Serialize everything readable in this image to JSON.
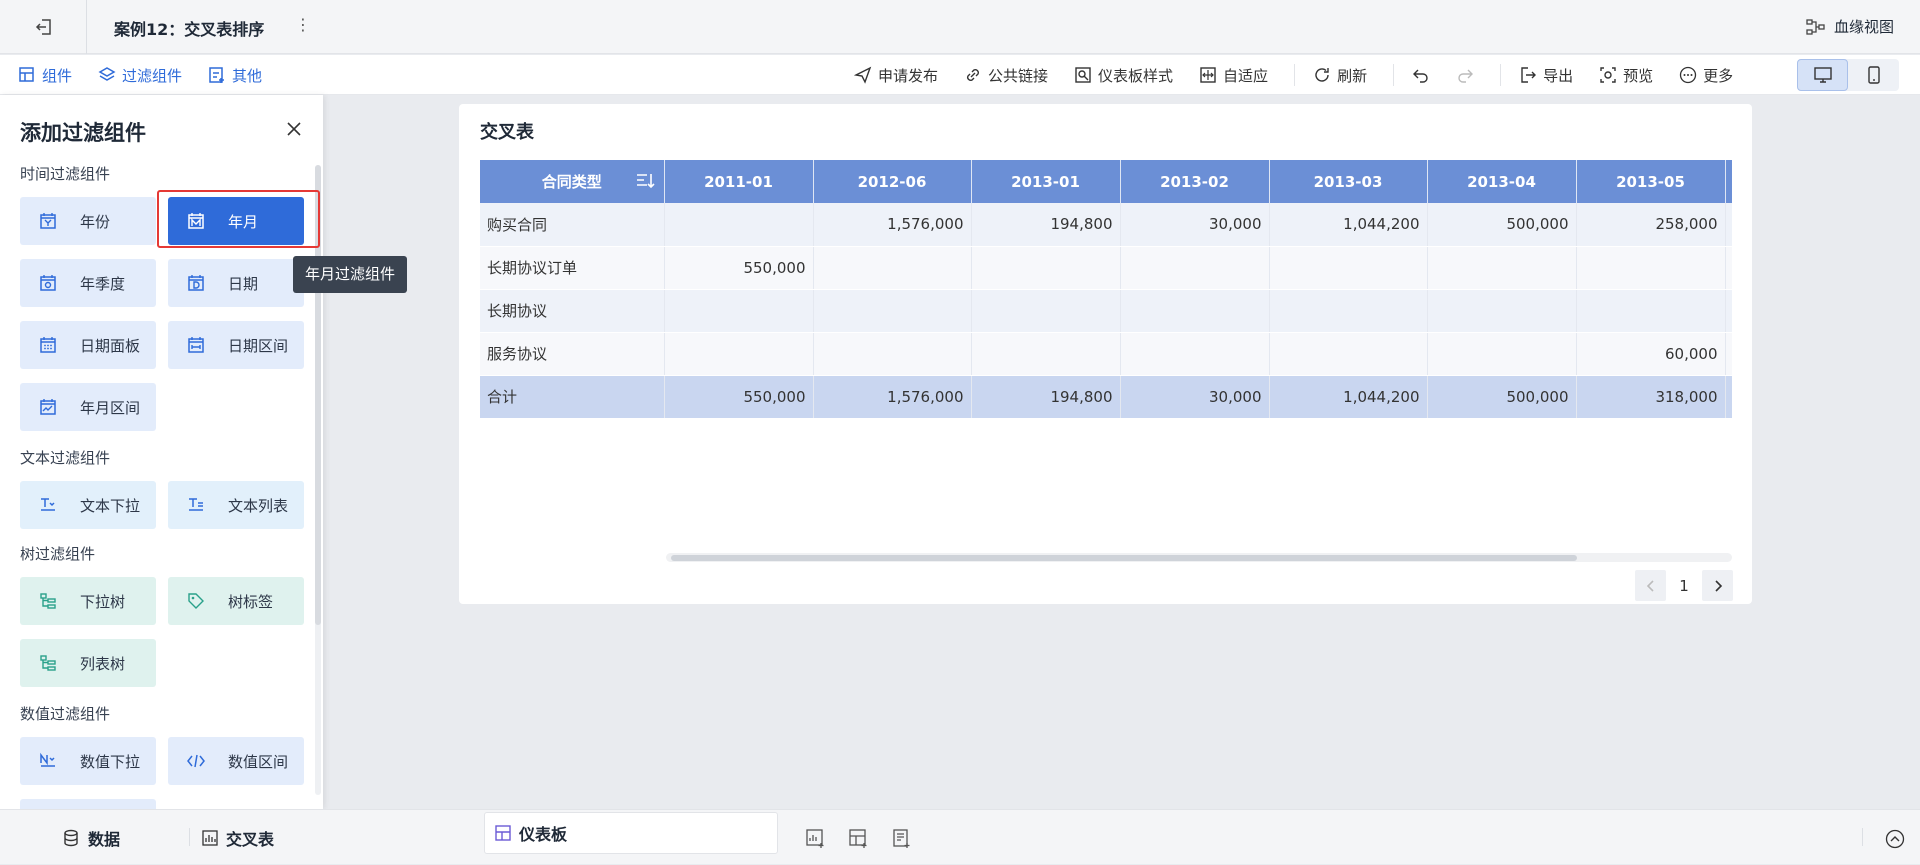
{
  "topbar": {
    "title": "案例12：交叉表排序",
    "lineage_label": "血缘视图"
  },
  "toolbar": {
    "left": [
      {
        "label": "组件",
        "icon": "add-component-icon"
      },
      {
        "label": "过滤组件",
        "icon": "filter-component-icon"
      },
      {
        "label": "其他",
        "icon": "other-icon"
      }
    ],
    "right": [
      {
        "label": "申请发布",
        "icon": "send-icon"
      },
      {
        "label": "公共链接",
        "icon": "link-icon"
      },
      {
        "label": "仪表板样式",
        "icon": "dashboard-style-icon"
      },
      {
        "label": "自适应",
        "icon": "adaptive-icon"
      },
      {
        "label": "刷新",
        "icon": "refresh-icon"
      },
      {
        "label": "导出",
        "icon": "export-icon"
      },
      {
        "label": "预览",
        "icon": "preview-icon"
      },
      {
        "label": "更多",
        "icon": "more-icon"
      }
    ]
  },
  "panel": {
    "title": "添加过滤组件",
    "sections": {
      "time": "时间过滤组件",
      "text": "文本过滤组件",
      "tree": "树过滤组件",
      "number": "数值过滤组件"
    },
    "buttons": {
      "year": "年份",
      "year_month": "年月",
      "year_quarter": "年季度",
      "date": "日期",
      "date_panel": "日期面板",
      "date_range": "日期区间",
      "year_month_range": "年月区间",
      "text_dropdown": "文本下拉",
      "text_list": "文本列表",
      "dropdown_tree": "下拉树",
      "tree_tag": "树标签",
      "list_tree": "列表树",
      "number_dropdown": "数值下拉",
      "number_range": "数值区间"
    },
    "tooltip": "年月过滤组件"
  },
  "card": {
    "title": "交叉表",
    "table": {
      "corner": "合同类型",
      "columns": [
        "2011-01",
        "2012-06",
        "2013-01",
        "2013-02",
        "2013-03",
        "2013-04",
        "2013-05"
      ],
      "rows": [
        {
          "label": "购买合同",
          "cells": [
            "",
            "1,576,000",
            "194,800",
            "30,000",
            "1,044,200",
            "500,000",
            "258,000"
          ]
        },
        {
          "label": "长期协议订单",
          "cells": [
            "550,000",
            "",
            "",
            "",
            "",
            "",
            ""
          ]
        },
        {
          "label": "长期协议",
          "cells": [
            "",
            "",
            "",
            "",
            "",
            "",
            ""
          ]
        },
        {
          "label": "服务协议",
          "cells": [
            "",
            "",
            "",
            "",
            "",
            "",
            "60,000"
          ]
        },
        {
          "label": "合计",
          "cells": [
            "550,000",
            "1,576,000",
            "194,800",
            "30,000",
            "1,044,200",
            "500,000",
            "318,000"
          ]
        }
      ]
    },
    "page": "1"
  },
  "bottombar": {
    "data": "数据",
    "crosstab": "交叉表",
    "dashboard": "仪表板"
  },
  "colors": {
    "accent": "#2f6bd9",
    "header": "#6b8fd6",
    "total_row": "#c9d6f0"
  }
}
